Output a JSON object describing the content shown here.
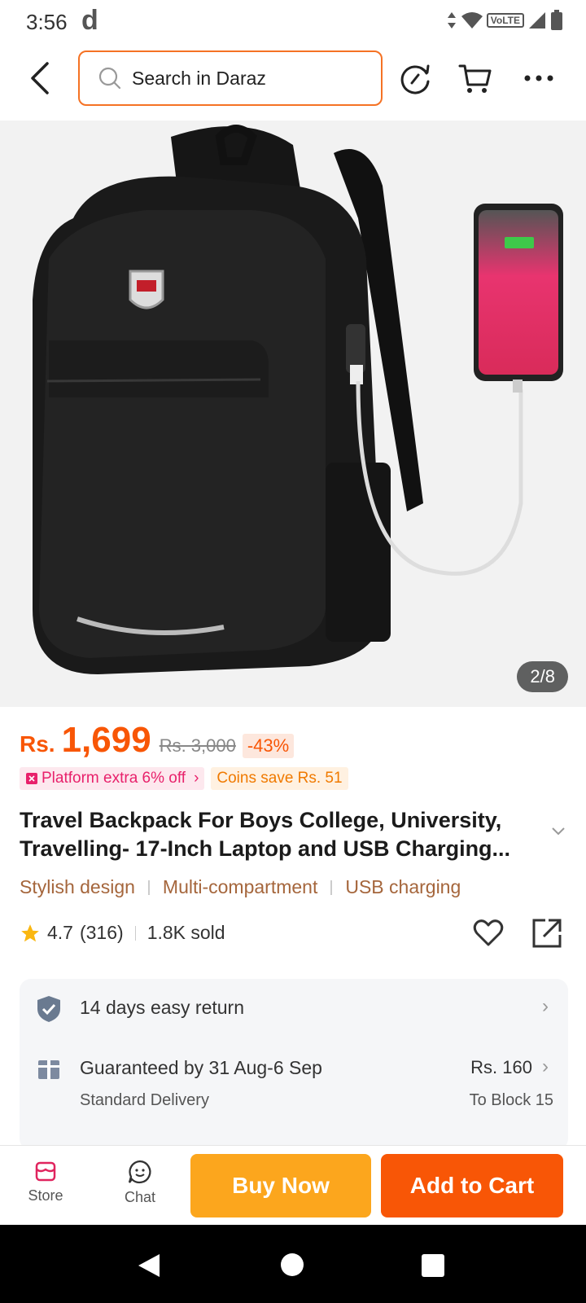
{
  "status_bar": {
    "time": "3:56",
    "app_letter": "d",
    "network_badge": "VoLTE"
  },
  "header": {
    "search_placeholder": "Search in Daraz"
  },
  "product_image": {
    "counter": "2/8"
  },
  "price": {
    "currency": "Rs.",
    "value": "1,699",
    "original": "Rs. 3,000",
    "discount": "-43%"
  },
  "promos": [
    {
      "label": "Platform extra 6% off"
    },
    {
      "label": "Coins save Rs. 51"
    }
  ],
  "product": {
    "title": "Travel Backpack For Boys College, University, Travelling- 17-Inch Laptop and USB Charging..."
  },
  "features": [
    "Stylish design",
    "Multi-compartment",
    "USB charging"
  ],
  "rating": {
    "score": "4.7",
    "count": "(316)",
    "sold": "1.8K sold"
  },
  "service": {
    "returns": "14 days easy return",
    "delivery": "Guaranteed by 31 Aug-6 Sep",
    "delivery_type": "Standard Delivery",
    "delivery_fee": "Rs. 160",
    "delivery_to": "To Block 15"
  },
  "action_bar": {
    "store_label": "Store",
    "chat_label": "Chat",
    "buy_now": "Buy Now",
    "add_to_cart": "Add to Cart"
  },
  "colors": {
    "brand_orange": "#f85606",
    "buy_now": "#fca61d",
    "feature_text": "#a5663c"
  },
  "icons": [
    "back-arrow-icon",
    "search-icon",
    "history-icon",
    "cart-icon",
    "more-icon",
    "heart-icon",
    "share-icon",
    "shield-check-icon",
    "package-icon",
    "store-icon",
    "chat-icon"
  ]
}
